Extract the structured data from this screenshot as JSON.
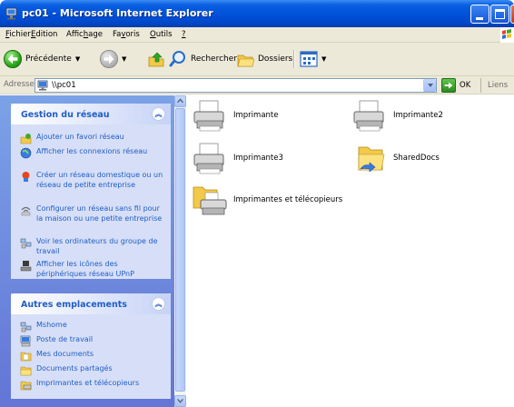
{
  "window": {
    "title": "pc01 - Microsoft Internet Explorer"
  },
  "menu": [
    {
      "pre": "",
      "u": "F",
      "post": "ichier"
    },
    {
      "pre": "",
      "u": "E",
      "post": "dition"
    },
    {
      "pre": "Affic",
      "u": "h",
      "post": "age"
    },
    {
      "pre": "Fa",
      "u": "v",
      "post": "oris"
    },
    {
      "pre": "",
      "u": "O",
      "post": "utils"
    },
    {
      "pre": "",
      "u": "?",
      "post": ""
    }
  ],
  "toolbar": {
    "back_label": "Précédente",
    "search_label": "Rechercher",
    "folders_label": "Dossiers"
  },
  "address": {
    "label": "Adresse",
    "value": "\\\\pc01",
    "go_label": "OK",
    "links_label": "Liens"
  },
  "network_tasks": {
    "title": "Gestion du réseau",
    "items": [
      {
        "label": "Ajouter un favori réseau",
        "icon": "add-network-place-icon"
      },
      {
        "label": "Afficher les connexions réseau",
        "icon": "network-connections-icon"
      },
      {
        "label": "Créer un réseau domestique ou un réseau de petite entreprise",
        "icon": "network-setup-icon"
      },
      {
        "label": "Configurer un réseau sans fil pour la maison ou une petite entreprise",
        "icon": "wireless-network-icon"
      },
      {
        "label": "Voir les ordinateurs du groupe de travail",
        "icon": "workgroup-icon"
      },
      {
        "label": "Afficher les icônes des périphériques réseau UPnP",
        "icon": "upnp-devices-icon"
      }
    ]
  },
  "other_places": {
    "title": "Autres emplacements",
    "items": [
      {
        "label": "Mshome",
        "icon": "workgroup-icon"
      },
      {
        "label": "Poste de travail",
        "icon": "my-computer-icon"
      },
      {
        "label": "Mes documents",
        "icon": "my-documents-icon"
      },
      {
        "label": "Documents partagés",
        "icon": "shared-documents-icon"
      },
      {
        "label": "Imprimantes et télécopieurs",
        "icon": "printers-faxes-icon"
      }
    ]
  },
  "shares": [
    {
      "label": "Imprimante",
      "icon": "printer-icon"
    },
    {
      "label": "Imprimante2",
      "icon": "printer-icon"
    },
    {
      "label": "Imprimante3",
      "icon": "printer-icon"
    },
    {
      "label": "SharedDocs",
      "icon": "shared-folder-icon"
    },
    {
      "label": "Imprimantes et télécopieurs",
      "icon": "printers-folder-icon"
    }
  ]
}
